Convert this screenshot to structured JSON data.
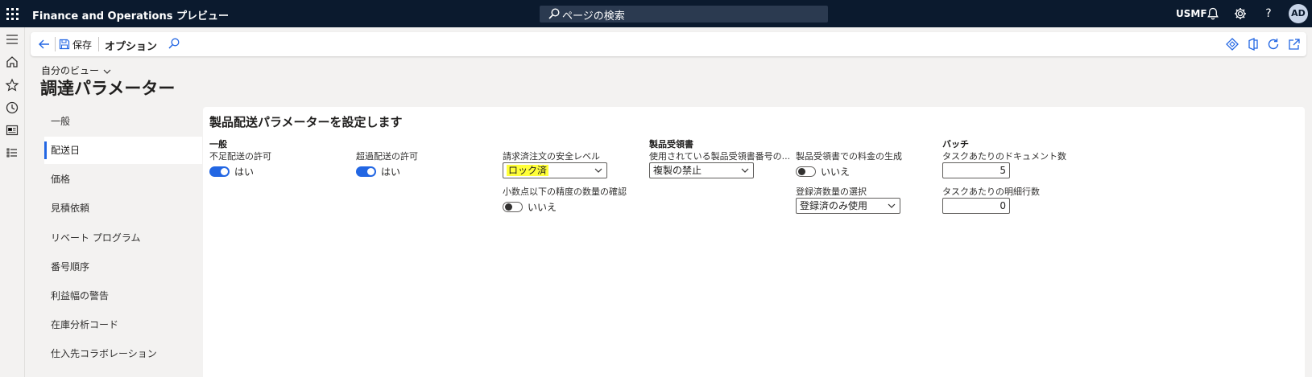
{
  "topbar": {
    "app_title": "Finance and Operations プレビュー",
    "search_placeholder": "ページの検索",
    "company": "USMF",
    "avatar_initials": "AD"
  },
  "actionbar": {
    "save_label": "保存",
    "options_label": "オプション"
  },
  "header": {
    "view_label": "自分のビュー",
    "page_title": "調達パラメーター"
  },
  "nav": {
    "items": [
      "一般",
      "配送日",
      "価格",
      "見積依頼",
      "リベート プログラム",
      "番号順序",
      "利益幅の警告",
      "在庫分析コード",
      "仕入先コラボレーション"
    ],
    "active": "配送日"
  },
  "content": {
    "section_title": "製品配送パラメーターを設定します",
    "general": {
      "title": "一般",
      "under_delivery_label": "不足配送の許可",
      "under_delivery_value": "はい"
    },
    "over_delivery": {
      "label": "超過配送の許可",
      "value": "はい"
    },
    "invoice": {
      "security_label": "請求済注文の安全レベル",
      "security_value": "ロック済",
      "decimal_label": "小数点以下の精度の数量の確認",
      "decimal_value": "いいえ"
    },
    "receipt": {
      "title": "製品受領書",
      "number_label": "使用されている製品受領書番号の...",
      "number_value": "複製の禁止"
    },
    "charges": {
      "label": "製品受領書での料金の生成",
      "value": "いいえ",
      "qty_label": "登録済数量の選択",
      "qty_value": "登録済のみ使用"
    },
    "batch": {
      "title": "バッチ",
      "docs_label": "タスクあたりのドキュメント数",
      "docs_value": "5",
      "lines_label": "タスクあたりの明細行数",
      "lines_value": "0"
    }
  },
  "colors": {
    "topbar": "#0b1a2e",
    "accent": "#2266e3",
    "highlight": "#ffff38"
  }
}
